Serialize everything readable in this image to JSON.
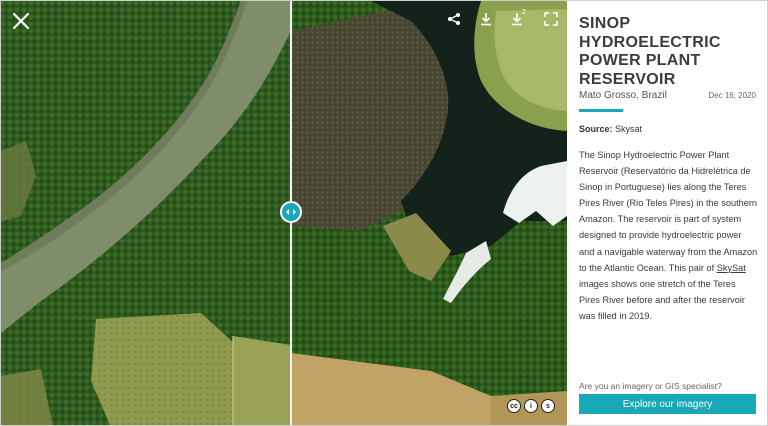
{
  "viewer": {
    "close_icon": "close-icon",
    "tools": [
      "share-icon",
      "download-icon",
      "download-2-icon",
      "fullscreen-icon"
    ],
    "download_second_label": "2",
    "handle_icon": "left-right-arrows-icon",
    "license_badges": [
      "cc",
      "i",
      "s"
    ],
    "accent_color": "#19a8b8"
  },
  "panel": {
    "title": "SINOP HYDROELECTRIC POWER PLANT RESERVOIR",
    "location": "Mato Grosso, Brazil",
    "date": "Dec 16, 2020",
    "source_label": "Source:",
    "source_value": "Skysat",
    "description_part1": "The Sinop Hydroelectric Power Plant Reservoir (Reservatório da Hidrelétrica de Sinop in Portuguese) lies along the Teres Pires River (Rio Teles Pires) in the southern Amazon. The reservoir is part of system designed to provide hydroelectric power and a navigable waterway from the Amazon to the Atlantic Ocean. This pair of ",
    "description_link": "SkySat",
    "description_part2": " images shows one stretch of the Teres Pires River before and after the reservoir was filled in 2019.",
    "cta_question": "Are you an imagery or GIS specialist?",
    "cta_button": "Explore our imagery"
  }
}
